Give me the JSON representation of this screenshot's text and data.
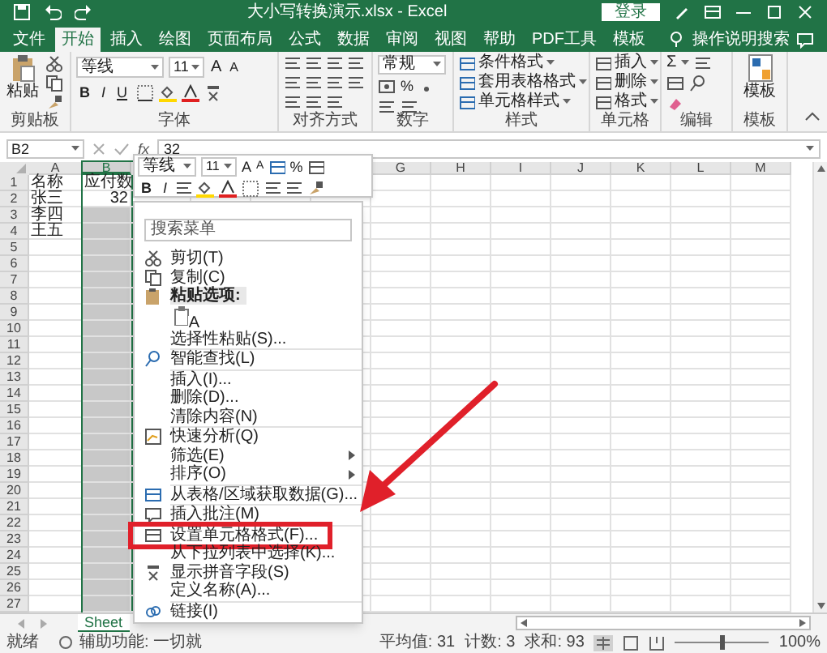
{
  "title_bar": {
    "title": "大小写转换演示.xlsx  -  Excel",
    "sign_in": "登录"
  },
  "tabs": [
    {
      "label": "文件",
      "selected": false
    },
    {
      "label": "开始",
      "selected": true
    },
    {
      "label": "插入",
      "selected": false
    },
    {
      "label": "绘图",
      "selected": false
    },
    {
      "label": "页面布局",
      "selected": false
    },
    {
      "label": "公式",
      "selected": false
    },
    {
      "label": "数据",
      "selected": false
    },
    {
      "label": "审阅",
      "selected": false
    },
    {
      "label": "视图",
      "selected": false
    },
    {
      "label": "帮助",
      "selected": false
    },
    {
      "label": "PDF工具",
      "selected": false
    },
    {
      "label": "模板",
      "selected": false
    }
  ],
  "tell_me": "操作说明搜索",
  "ribbon": {
    "clipboard": {
      "paste": "粘贴",
      "label": "剪贴板"
    },
    "font": {
      "name": "等线",
      "size": "11",
      "size_buttons": [
        "A",
        "A"
      ],
      "style_buttons": [
        "B",
        "I",
        "U"
      ],
      "label": "字体"
    },
    "alignment": {
      "label": "对齐方式"
    },
    "number": {
      "format": "常规",
      "percent": "%",
      "label": "数字"
    },
    "styles": {
      "items": [
        "条件格式",
        "套用表格格式",
        "单元格样式"
      ],
      "label": "样式"
    },
    "cells": {
      "items": [
        "插入",
        "删除",
        "格式"
      ],
      "label": "单元格"
    },
    "editing": {
      "sum": "Σ",
      "label": "编辑"
    },
    "templates": {
      "button": "模板",
      "label": "模板"
    }
  },
  "formula_bar": {
    "name_box": "B2",
    "fx": "fx",
    "value": "32"
  },
  "mini_toolbar": {
    "font": "等线",
    "size": "11",
    "size_buttons": [
      "A",
      "A"
    ],
    "percent": "%",
    "style_buttons": [
      "B",
      "I"
    ]
  },
  "columns": [
    {
      "kind": "column",
      "label": "A",
      "selected": false
    },
    {
      "kind": "column",
      "label": "B",
      "selected": true
    },
    {
      "kind": "covered"
    },
    {
      "kind": "covered"
    },
    {
      "kind": "covered"
    },
    {
      "kind": "covered"
    },
    {
      "kind": "column",
      "label": "G",
      "selected": false
    },
    {
      "kind": "column",
      "label": "H",
      "selected": false
    },
    {
      "kind": "column",
      "label": "I",
      "selected": false
    },
    {
      "kind": "column",
      "label": "J",
      "selected": false
    },
    {
      "kind": "column",
      "label": "K",
      "selected": false
    },
    {
      "kind": "column",
      "label": "L",
      "selected": false
    },
    {
      "kind": "column",
      "label": "M",
      "selected": false
    }
  ],
  "rows": [
    {
      "header": "1",
      "cells": [
        "名称",
        "应付数"
      ]
    },
    {
      "header": "2",
      "cells": [
        "张三",
        "32"
      ]
    },
    {
      "header": "3",
      "cells": [
        "李四"
      ]
    },
    {
      "header": "4",
      "cells": [
        "王五"
      ]
    },
    {
      "header": "5"
    },
    {
      "header": "6"
    },
    {
      "header": "7"
    },
    {
      "header": "8"
    },
    {
      "header": "9"
    },
    {
      "header": "10"
    },
    {
      "header": "11"
    },
    {
      "header": "12"
    },
    {
      "header": "13"
    },
    {
      "header": "14"
    },
    {
      "header": "15"
    },
    {
      "header": "16"
    },
    {
      "header": "17"
    },
    {
      "header": "18"
    },
    {
      "header": "19"
    },
    {
      "header": "20"
    },
    {
      "header": "21"
    },
    {
      "header": "22"
    },
    {
      "header": "23"
    },
    {
      "header": "24"
    },
    {
      "header": "25"
    },
    {
      "header": "26"
    },
    {
      "header": "27"
    }
  ],
  "sheet_tab": "Sheet",
  "context_menu": [
    {
      "kind": "search",
      "placeholder": "搜索菜单"
    },
    {
      "kind": "item",
      "label": "剪切(T)",
      "submenu": false,
      "annotated": false
    },
    {
      "kind": "item",
      "label": "复制(C)",
      "submenu": false,
      "annotated": false
    },
    {
      "kind": "header",
      "label": "粘贴选项:"
    },
    {
      "kind": "paste_button",
      "label": "A"
    },
    {
      "kind": "item",
      "label": "选择性粘贴(S)...",
      "submenu": false,
      "annotated": false
    },
    {
      "kind": "separator"
    },
    {
      "kind": "item",
      "label": "智能查找(L)",
      "submenu": false,
      "annotated": false
    },
    {
      "kind": "separator"
    },
    {
      "kind": "item",
      "label": "插入(I)...",
      "submenu": false,
      "annotated": false
    },
    {
      "kind": "item",
      "label": "删除(D)...",
      "submenu": false,
      "annotated": false
    },
    {
      "kind": "item",
      "label": "清除内容(N)",
      "submenu": false,
      "annotated": false
    },
    {
      "kind": "separator"
    },
    {
      "kind": "item",
      "label": "快速分析(Q)",
      "submenu": false,
      "annotated": false
    },
    {
      "kind": "item",
      "label": "筛选(E)",
      "submenu": true,
      "annotated": false
    },
    {
      "kind": "item",
      "label": "排序(O)",
      "submenu": true,
      "annotated": false
    },
    {
      "kind": "separator"
    },
    {
      "kind": "item",
      "label": "从表格/区域获取数据(G)...",
      "submenu": false,
      "annotated": false
    },
    {
      "kind": "separator"
    },
    {
      "kind": "item",
      "label": "插入批注(M)",
      "submenu": false,
      "annotated": false
    },
    {
      "kind": "separator"
    },
    {
      "kind": "item",
      "label": "设置单元格格式(F)...",
      "submenu": false,
      "annotated": true
    },
    {
      "kind": "item",
      "label": "从下拉列表中选择(K)...",
      "submenu": false,
      "annotated": false
    },
    {
      "kind": "item",
      "label": "显示拼音字段(S)",
      "submenu": false,
      "annotated": false
    },
    {
      "kind": "item",
      "label": "定义名称(A)...",
      "submenu": false,
      "annotated": false
    },
    {
      "kind": "separator"
    },
    {
      "kind": "item",
      "label": "链接(I)",
      "submenu": false,
      "annotated": false
    }
  ],
  "status_bar": {
    "status": "就绪",
    "accessibility": "辅助功能: 一切就",
    "stats": [
      "平均值: 31",
      "计数: 3",
      "求和: 93"
    ],
    "zoom": "100%",
    "zoom_slider": {
      "level": 0.5
    }
  }
}
